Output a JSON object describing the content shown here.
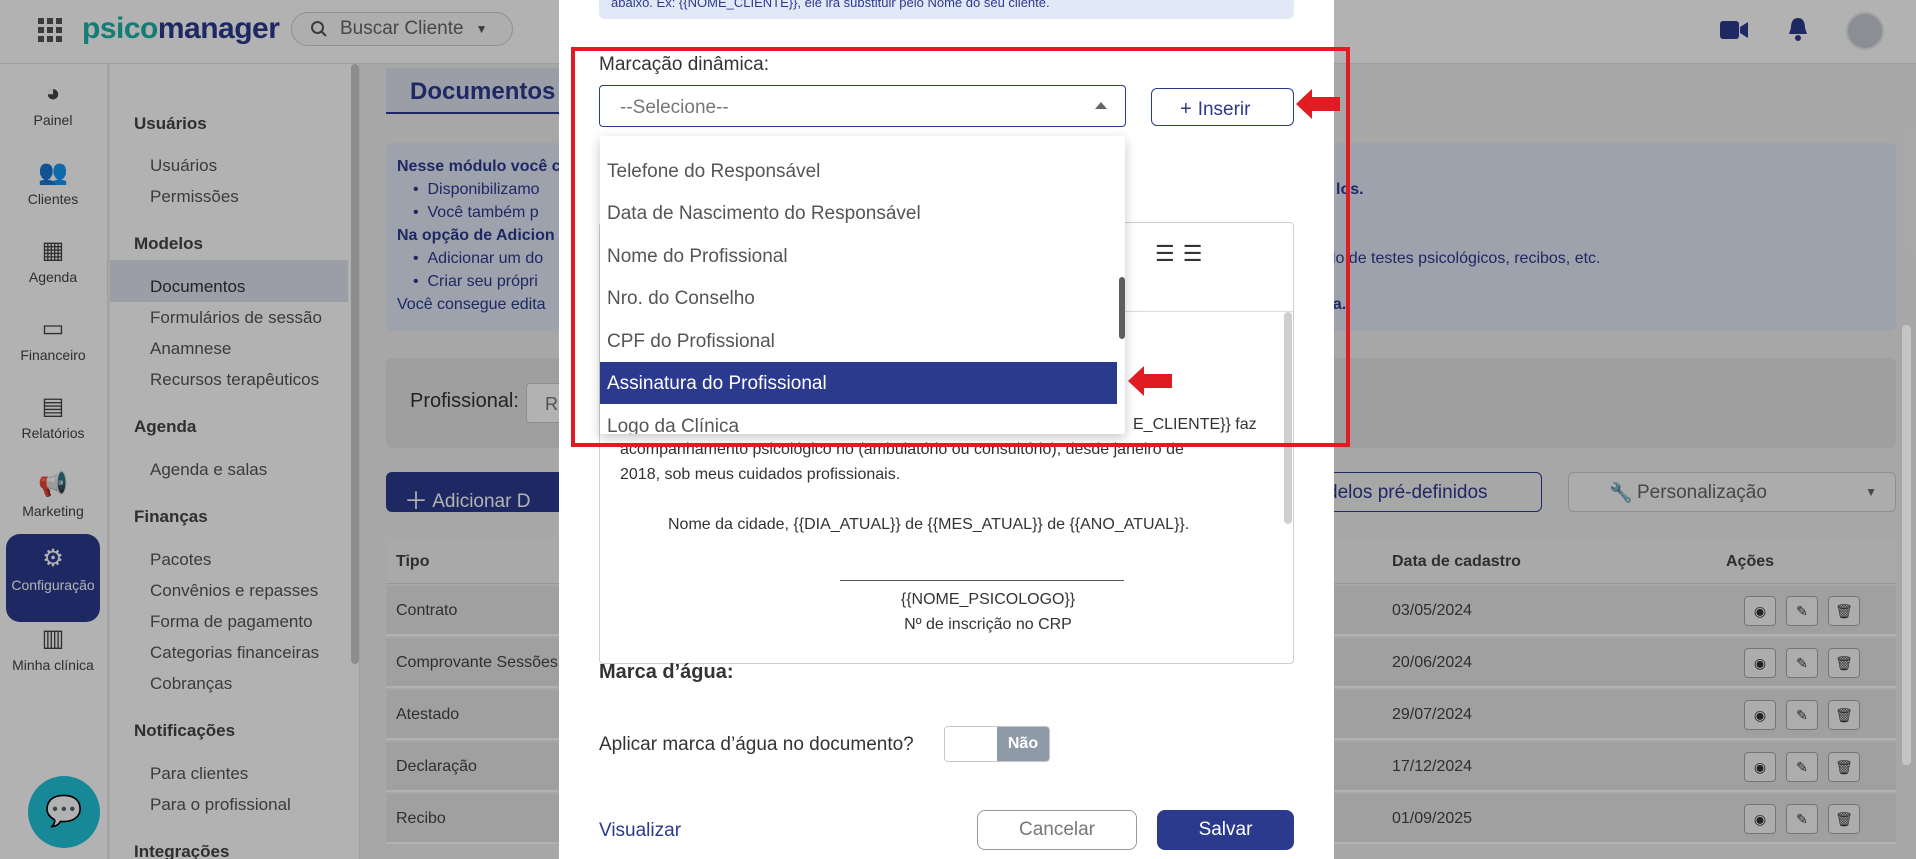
{
  "topbar": {
    "logo_prefix": "psico",
    "logo_suffix": "manager",
    "search_label": "Buscar Cliente",
    "icons": [
      "apps-grid-icon",
      "search-icon",
      "video-camera-icon",
      "bell-icon"
    ]
  },
  "leftnav": [
    {
      "label": "Painel",
      "icon": "dashboard-icon"
    },
    {
      "label": "Clientes",
      "icon": "users-icon"
    },
    {
      "label": "Agenda",
      "icon": "calendar-icon"
    },
    {
      "label": "Financeiro",
      "icon": "money-icon"
    },
    {
      "label": "Relatórios",
      "icon": "report-icon"
    },
    {
      "label": "Marketing",
      "icon": "megaphone-icon"
    },
    {
      "label": "Configuração",
      "icon": "gear-icon",
      "active": true
    },
    {
      "label": "Minha clínica",
      "icon": "building-icon"
    }
  ],
  "submenu": {
    "sections": [
      {
        "title": "Usuários",
        "items": [
          "Usuários",
          "Permissões"
        ]
      },
      {
        "title": "Modelos",
        "items": [
          "Documentos",
          "Formulários de sessão",
          "Anamnese",
          "Recursos terapêuticos"
        ]
      },
      {
        "title": "Agenda",
        "items": [
          "Agenda e salas"
        ]
      },
      {
        "title": "Finanças",
        "items": [
          "Pacotes",
          "Convênios e repasses",
          "Forma de pagamento",
          "Categorias financeiras",
          "Cobranças"
        ]
      },
      {
        "title": "Notificações",
        "items": [
          "Para clientes",
          "Para o profissional"
        ]
      },
      {
        "title": "Integrações",
        "items": []
      }
    ]
  },
  "main": {
    "title": "Documentos",
    "info_lines": [
      "Nesse módulo você c",
      "Disponibilizamo",
      "Você também p",
      "Na opção de Adicion",
      "Adicionar um do",
      "Criar seu própri",
      "Você consegue edita",
      "los.",
      "elo de testes psicológicos, recibos, etc.",
      "ea."
    ],
    "filter_label": "Profissional:",
    "filter_value": "R",
    "add_button": "Adicionar D",
    "models_button": "delos pré-definidos",
    "personalize_button": "Personalização",
    "table": {
      "headers": [
        "Tipo",
        "Data de cadastro",
        "Ações"
      ],
      "rows": [
        {
          "tipo": "Contrato",
          "data": "03/05/2024"
        },
        {
          "tipo": "Comprovante Sessões",
          "data": "20/06/2024"
        },
        {
          "tipo": "Atestado",
          "data": "29/07/2024"
        },
        {
          "tipo": "Declaração",
          "data": "17/12/2024"
        },
        {
          "tipo": "Recibo",
          "data": "01/09/2025"
        }
      ]
    }
  },
  "modal": {
    "hint_text": "abaixo. Ex: {{NOME_CLIENTE}}, ele irá substituir pelo Nome do seu cliente.",
    "dynamic_label": "Marcação dinâmica:",
    "select_placeholder": "--Selecione--",
    "insert_button": "Inserir",
    "dropdown_options": [
      "Telefone do Responsável",
      "Data de Nascimento do Responsável",
      "Nome do Profissional",
      "Nro. do Conselho",
      "CPF do Profissional",
      "Assinatura do Profissional",
      "Logo da Clínica"
    ],
    "selected_option": "Assinatura do Profissional",
    "editor_lines": [
      "E_CLIENTE}} faz",
      "acompanhamento psicológico no (ambulatório ou consultório), desde janeiro de",
      "2018, sob meus cuidados profissionais.",
      "Nome da cidade, {{DIA_ATUAL}} de {{MES_ATUAL}} de {{ANO_ATUAL}}.",
      "{{NOME_PSICOLOGO}}",
      "Nº de inscrição no CRP"
    ],
    "watermark_title": "Marca d’água:",
    "watermark_question": "Aplicar marca d’água no documento?",
    "watermark_toggle": "Não",
    "preview_link": "Visualizar",
    "cancel_button": "Cancelar",
    "save_button": "Salvar"
  },
  "colors": {
    "brand_navy": "#2c3a8e",
    "brand_teal": "#1bb3a6",
    "annotation_red": "#e11b22",
    "chat_fab": "#22c3d8"
  }
}
